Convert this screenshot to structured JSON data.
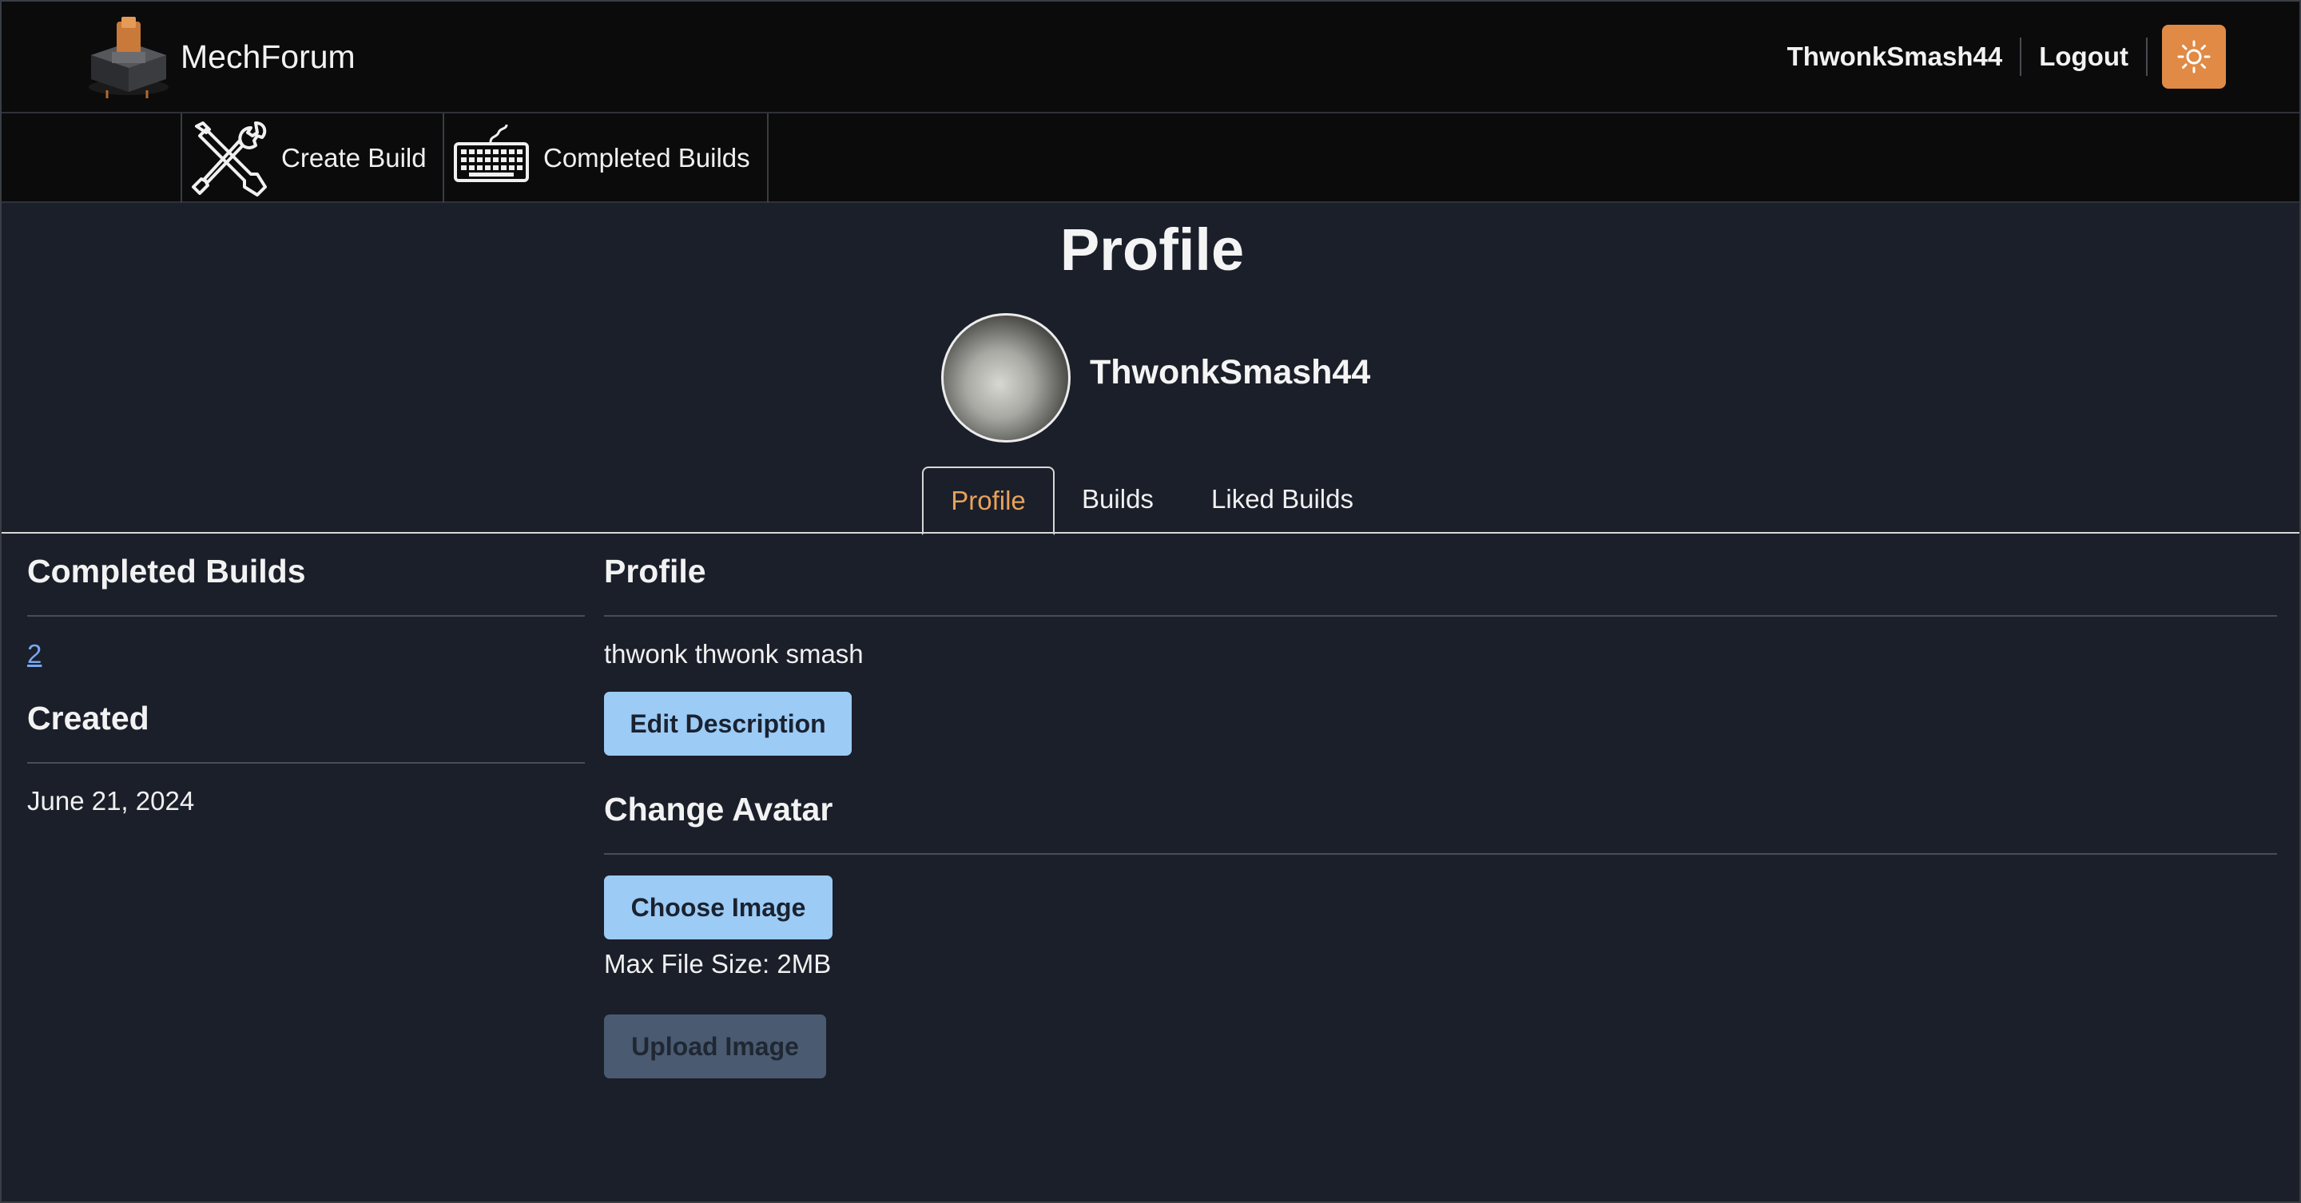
{
  "brand": {
    "name": "MechForum"
  },
  "user": {
    "username": "ThwonkSmash44",
    "logout_label": "Logout"
  },
  "nav": {
    "create_label": "Create Build",
    "completed_label": "Completed Builds"
  },
  "page": {
    "title": "Profile"
  },
  "profile": {
    "display_name": "ThwonkSmash44"
  },
  "tabs": [
    {
      "label": "Profile",
      "active": true
    },
    {
      "label": "Builds",
      "active": false
    },
    {
      "label": "Liked Builds",
      "active": false
    }
  ],
  "left": {
    "completed_heading": "Completed Builds",
    "completed_count": "2",
    "created_heading": "Created",
    "created_date": "June 21, 2024"
  },
  "right": {
    "profile_heading": "Profile",
    "description": "thwonk thwonk smash",
    "edit_button": "Edit Description",
    "avatar_heading": "Change Avatar",
    "choose_button": "Choose Image",
    "max_size": "Max File Size: 2MB",
    "upload_button": "Upload Image"
  },
  "colors": {
    "accent_orange": "#e08a45",
    "active_tab_text": "#e8a25a",
    "primary_button": "#9ccbf5",
    "disabled_button": "#4a5a70",
    "link": "#7aa7f0",
    "background": "#1b1f2a",
    "topbar": "#0b0b0c"
  },
  "icons": {
    "logo": "keyboard-switch-logo-icon",
    "theme": "sun-icon",
    "create": "tools-icon",
    "completed": "keyboard-icon"
  }
}
